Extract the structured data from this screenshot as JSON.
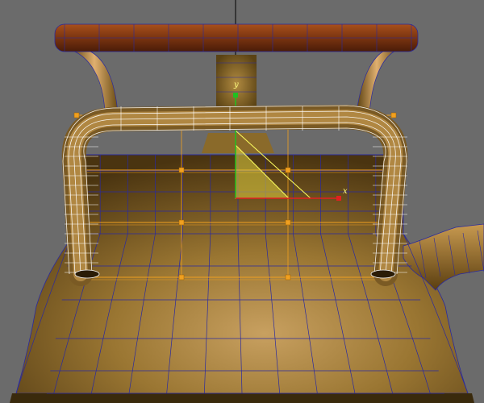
{
  "viewport": {
    "background_color": "#6b6b6b",
    "wire_color": "#2a2aa0",
    "gizmo_color": "#f0a020",
    "selection_color": "#ffffff"
  },
  "scene": {
    "object_names": [
      "teapot-body",
      "top-handle",
      "selected-front-handle",
      "spout",
      "lid"
    ],
    "body_color": "#8a6a2a",
    "handle_color": "#c08a40",
    "lid_color": "#8a3a10"
  },
  "gizmo": {
    "x_axis_label": "x",
    "y_axis_label": "y",
    "x_axis_color": "#e02020",
    "y_axis_color": "#20c020"
  }
}
